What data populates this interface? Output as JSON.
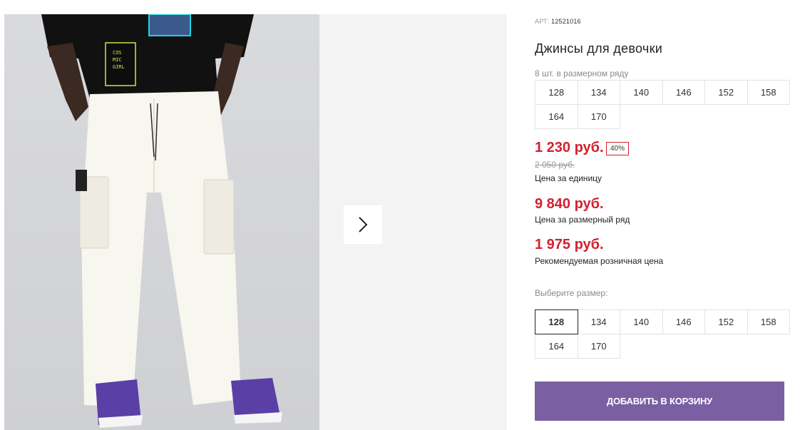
{
  "product": {
    "art_label": "АРТ:",
    "art_number": "12521016",
    "title": "Джинсы для девочки",
    "pack_note": "8 шт. в размерном ряду",
    "pack_sizes": [
      "128",
      "134",
      "140",
      "146",
      "152",
      "158",
      "164",
      "170"
    ],
    "price": "1 230 руб.",
    "discount": "40%",
    "old_price": "2 050 руб.",
    "price_unit_label": "Цена за единицу",
    "price_pack": "9 840 руб.",
    "price_pack_label": "Цена за размерный ряд",
    "price_rrp": "1 975 руб.",
    "price_rrp_label": "Рекомендуемая розничная цена",
    "choose_size_label": "Выберите размер:",
    "select_sizes": [
      "128",
      "134",
      "140",
      "146",
      "152",
      "158",
      "164",
      "170"
    ],
    "selected_size": "128",
    "add_to_cart": "ДОБАВИТЬ В КОРЗИНУ"
  },
  "gallery": {
    "next_icon": "chevron-right-icon"
  },
  "colors": {
    "price_red": "#d4202e",
    "cart_button": "#7a5fa3"
  }
}
